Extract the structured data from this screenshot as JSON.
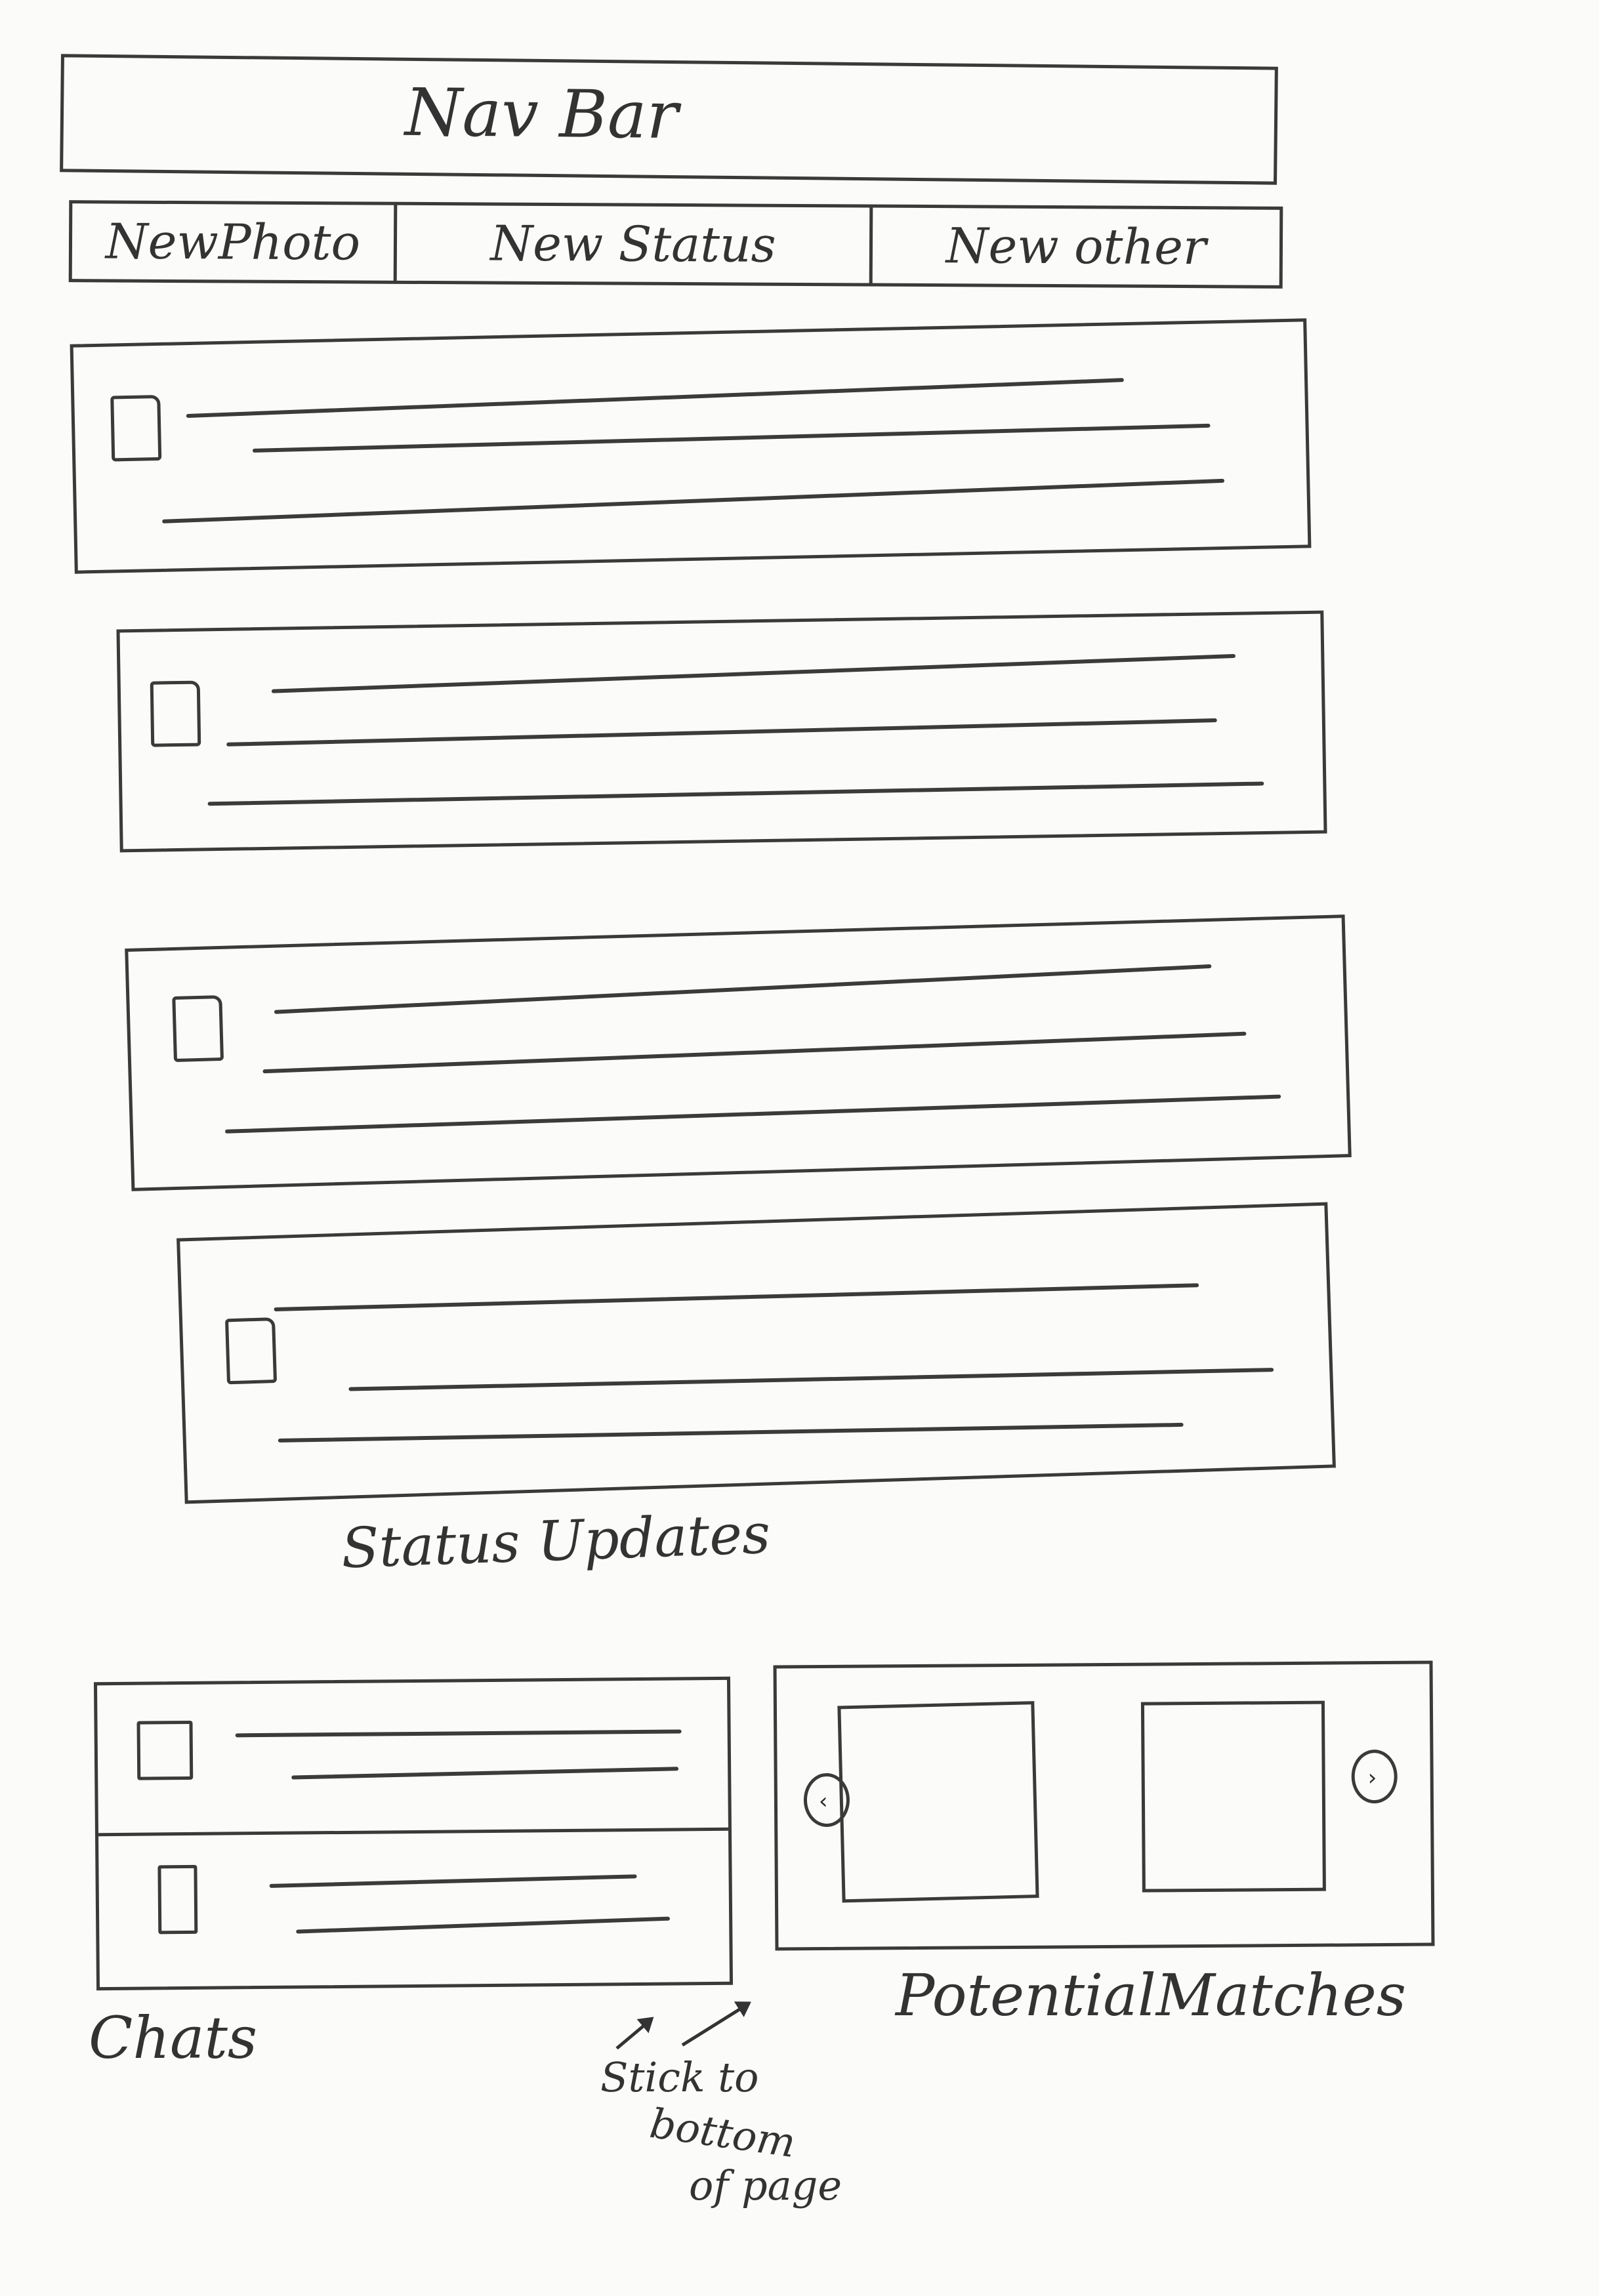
{
  "nav_bar": {
    "label": "Nav Bar"
  },
  "composer": {
    "new_photo": "NewPhoto",
    "new_status": "New Status",
    "new_other": "New other"
  },
  "status_updates": {
    "caption": "Status Updates",
    "posts": [
      {
        "thumb_icon": "avatar-placeholder"
      },
      {
        "thumb_icon": "avatar-placeholder"
      },
      {
        "thumb_icon": "avatar-placeholder"
      },
      {
        "thumb_icon": "avatar-placeholder"
      }
    ]
  },
  "chats": {
    "caption": "Chats",
    "items": [
      {
        "thumb_icon": "avatar-placeholder"
      },
      {
        "thumb_icon": "avatar-placeholder"
      }
    ]
  },
  "potential_matches": {
    "caption": "PotentialMatches",
    "prev_icon": "chevron-left-icon",
    "next_icon": "chevron-right-icon"
  },
  "annotation": {
    "line1": "Stick to",
    "line2": "bottom",
    "line3": "of page"
  }
}
